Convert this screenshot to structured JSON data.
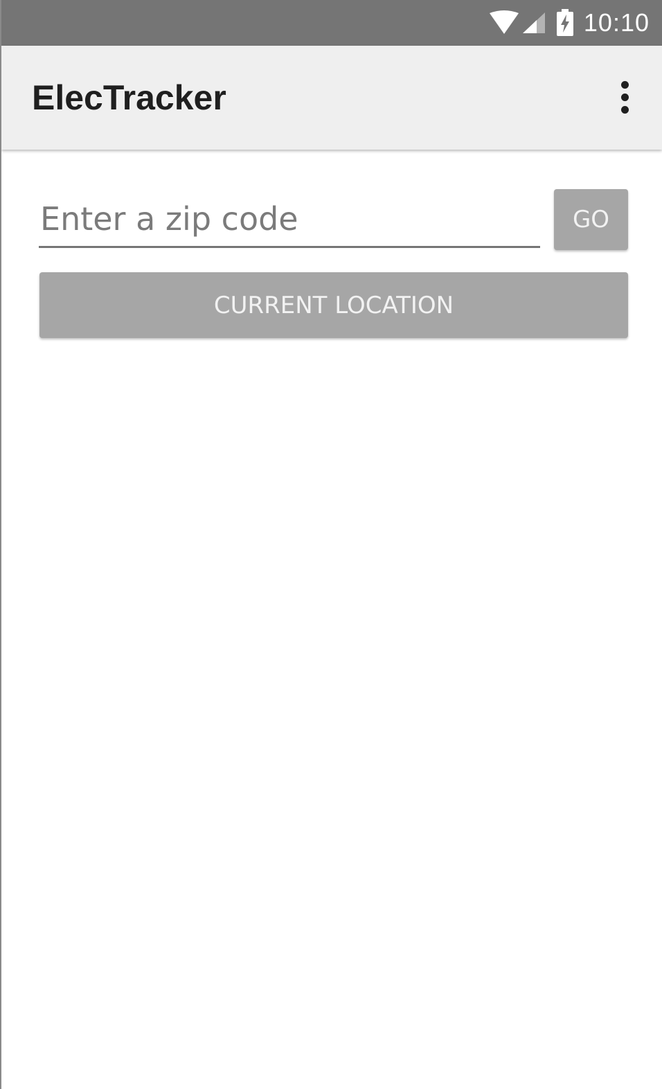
{
  "status_bar": {
    "time": "10:10",
    "icons": [
      "wifi-icon",
      "cellular-signal-icon",
      "battery-charging-icon"
    ],
    "background": "#757575"
  },
  "app_bar": {
    "title": "ElecTracker",
    "overflow_icon": "more-vert-icon",
    "background": "#efefef"
  },
  "search": {
    "zip_placeholder": "Enter a zip code",
    "zip_value": "",
    "go_label": "GO"
  },
  "location": {
    "button_label": "CURRENT LOCATION"
  },
  "colors": {
    "button_background": "#a6a6a6",
    "button_text": "#f2f2f2"
  }
}
